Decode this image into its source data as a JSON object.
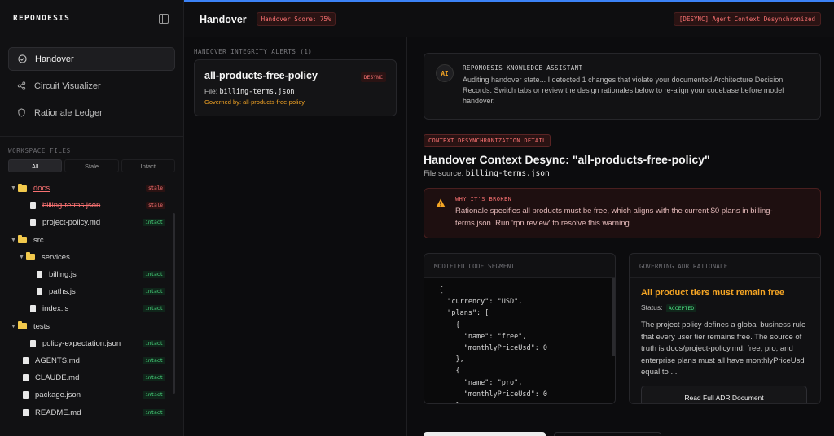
{
  "brand": "REPONOESIS",
  "nav": [
    {
      "label": "Handover",
      "icon": "check-circle-icon",
      "active": true
    },
    {
      "label": "Circuit Visualizer",
      "icon": "share-icon",
      "active": false
    },
    {
      "label": "Rationale Ledger",
      "icon": "shield-icon",
      "active": false
    }
  ],
  "workspace": {
    "label": "WORKSPACE FILES",
    "filters": [
      "All",
      "Stale",
      "Intact"
    ],
    "active_filter": "All",
    "tree": [
      {
        "name": "docs",
        "type": "folder",
        "badge": "stale"
      },
      {
        "name": "billing-terms.json",
        "type": "file",
        "badge": "stale"
      },
      {
        "name": "project-policy.md",
        "type": "file",
        "badge": "intact"
      },
      {
        "name": "src",
        "type": "folder",
        "badge": ""
      },
      {
        "name": "services",
        "type": "folder",
        "badge": ""
      },
      {
        "name": "billing.js",
        "type": "file",
        "badge": "intact"
      },
      {
        "name": "paths.js",
        "type": "file",
        "badge": "intact"
      },
      {
        "name": "index.js",
        "type": "file",
        "badge": "intact"
      },
      {
        "name": "tests",
        "type": "folder",
        "badge": ""
      },
      {
        "name": "policy-expectation.json",
        "type": "file",
        "badge": "intact"
      },
      {
        "name": "AGENTS.md",
        "type": "file",
        "badge": "intact"
      },
      {
        "name": "CLAUDE.md",
        "type": "file",
        "badge": "intact"
      },
      {
        "name": "package.json",
        "type": "file",
        "badge": "intact"
      },
      {
        "name": "README.md",
        "type": "file",
        "badge": "intact"
      }
    ]
  },
  "topbar": {
    "title": "Handover",
    "score": "Handover Score: 75%",
    "status": "[DESYNC] Agent Context Desynchronized"
  },
  "alerts": {
    "label": "HANDOVER INTEGRITY ALERTS (1)",
    "card": {
      "title": "all-products-free-policy",
      "badge": "DESYNC",
      "file_label": "File:",
      "file": "billing-terms.json",
      "governed": "Governed by: all-products-free-policy"
    }
  },
  "assistant": {
    "icon": "AI",
    "title": "REPONOESIS KNOWLEDGE ASSISTANT",
    "message": "Auditing handover state... I detected 1 changes that violate your documented Architecture Decision Records. Switch tabs or review the design rationales below to re-align your codebase before model handover."
  },
  "detail": {
    "badge": "CONTEXT DESYNCHRONIZATION DETAIL",
    "title": "Handover Context Desync: \"all-products-free-policy\"",
    "source_label": "File source:",
    "source": "billing-terms.json",
    "why_title": "WHY IT'S BROKEN",
    "why_text": "Rationale specifies all products must be free, which aligns with the current $0 plans in billing-terms.json. Run 'rpn review' to resolve this warning."
  },
  "code_panel": {
    "header": "MODIFIED CODE SEGMENT",
    "lines": [
      "{",
      "  \"currency\": \"USD\",",
      "  \"plans\": [",
      "    {",
      "      \"name\": \"free\",",
      "      \"monthlyPriceUsd\": 0",
      "    },",
      "    {",
      "      \"name\": \"pro\",",
      "      \"monthlyPriceUsd\": 0",
      "    }"
    ]
  },
  "adr_panel": {
    "header": "GOVERNING ADR RATIONALE",
    "title": "All product tiers must remain free",
    "status_label": "Status:",
    "status": "ACCEPTED",
    "text": "The project policy defines a global business rule that every user tier remains free. The source of truth is docs/project-policy.md: free, pro, and enterprise plans must all have monthlyPriceUsd equal to ...",
    "button": "Read Full ADR Document"
  }
}
